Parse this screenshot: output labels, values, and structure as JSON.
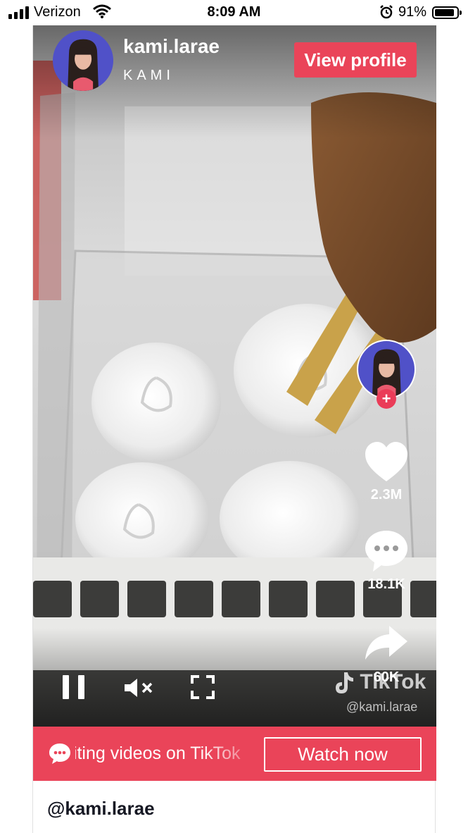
{
  "status_bar": {
    "carrier": "Verizon",
    "time": "8:09 AM",
    "battery": "91%",
    "battery_level": 0.91
  },
  "author": {
    "username": "kami.larae",
    "display_name": "KAMI"
  },
  "header": {
    "view_profile_label": "View profile"
  },
  "actions": {
    "likes": "2.3M",
    "comments": "18.1K",
    "shares": "60K"
  },
  "watermark": {
    "brand": "TikTok",
    "handle": "@kami.larae"
  },
  "banner": {
    "promo_text": "exciting videos on TikTok",
    "watch_label": "Watch now"
  },
  "footer": {
    "handle": "@kami.larae"
  },
  "colors": {
    "accent": "#ea4459",
    "avatar_bg": "#5051c8"
  },
  "icons": [
    "signal-icon",
    "wifi-icon",
    "alarm-icon",
    "battery-icon",
    "heart-icon",
    "comment-icon",
    "share-icon",
    "pause-icon",
    "mute-icon",
    "fullscreen-icon",
    "tiktok-logo-icon",
    "chat-bubble-icon"
  ]
}
